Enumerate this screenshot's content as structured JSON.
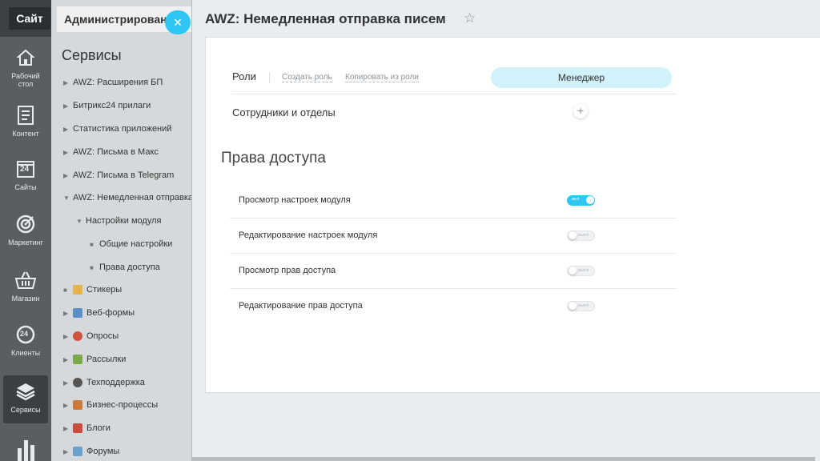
{
  "rail": {
    "site_label": "Сайт",
    "items": [
      {
        "label": "Рабочий стол",
        "icon": "home-icon"
      },
      {
        "label": "Контент",
        "icon": "document-icon"
      },
      {
        "label": "Сайты",
        "icon": "calendar-24-icon"
      },
      {
        "label": "Маркетинг",
        "icon": "target-icon"
      },
      {
        "label": "Магазин",
        "icon": "basket-icon"
      },
      {
        "label": "Клиенты",
        "icon": "clients-24-icon"
      },
      {
        "label": "Сервисы",
        "icon": "layers-icon"
      }
    ],
    "calendar_num": "24",
    "clients_num": "24"
  },
  "tree": {
    "tab_label": "Администрирование",
    "title": "Сервисы",
    "items": [
      {
        "label": "AWZ: Расширения БП"
      },
      {
        "label": "Битрикс24 прилаги"
      },
      {
        "label": "Статистика приложений"
      },
      {
        "label": "AWZ: Письма в Макс"
      },
      {
        "label": "AWZ: Письма в Telegram"
      },
      {
        "label": "AWZ: Немедленная отправка"
      },
      {
        "label": "Настройки модуля"
      },
      {
        "label": "Общие настройки"
      },
      {
        "label": "Права доступа"
      },
      {
        "label": "Стикеры"
      },
      {
        "label": "Веб-формы"
      },
      {
        "label": "Опросы"
      },
      {
        "label": "Рассылки"
      },
      {
        "label": "Техподдержка"
      },
      {
        "label": "Бизнес-процессы"
      },
      {
        "label": "Блоги"
      },
      {
        "label": "Форумы"
      }
    ]
  },
  "main": {
    "title": "AWZ: Немедленная отправка писем",
    "roles_label": "Роли",
    "create_role": "Создать роль",
    "copy_role": "Копировать из роли",
    "role_name": "Менеджер",
    "staff_label": "Сотрудники и отделы",
    "add_symbol": "+",
    "section_title": "Права доступа",
    "permissions": [
      {
        "label": "Просмотр настроек модуля",
        "state": "вкл",
        "on": true
      },
      {
        "label": "Редактирование настроек модуля",
        "state": "выкл",
        "on": false
      },
      {
        "label": "Просмотр прав доступа",
        "state": "выкл",
        "on": false
      },
      {
        "label": "Редактирование прав доступа",
        "state": "выкл",
        "on": false
      }
    ]
  },
  "colors": {
    "accent": "#2fc6f6",
    "rail": "#5a5e62",
    "pill": "#d1f1fb"
  }
}
